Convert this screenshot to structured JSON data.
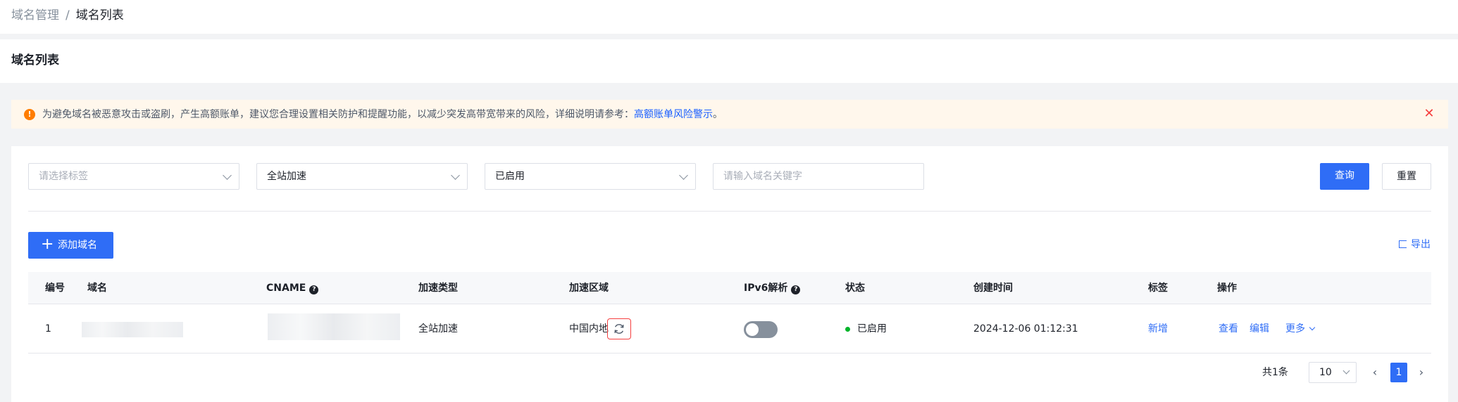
{
  "breadcrumb": {
    "parent": "域名管理",
    "separator": "/",
    "current": "域名列表"
  },
  "page_title": "域名列表",
  "alert": {
    "text": "为避免域名被恶意攻击或盗刷，产生高额账单，建议您合理设置相关防护和提醒功能，以减少突发高带宽带来的风险，详细说明请参考：",
    "link": "高额账单风险警示",
    "tail": "。",
    "icon": "warning-icon",
    "close_icon": "close-icon",
    "colors": {
      "background": "#fff7ec",
      "icon": "#ff7d00",
      "close": "#f53f3f",
      "link": "#165dff"
    }
  },
  "filters": {
    "tag_placeholder": "请选择标签",
    "accel_type": "全站加速",
    "status": "已启用",
    "keyword_placeholder": "请输入域名关键字",
    "query_label": "查询",
    "reset_label": "重置"
  },
  "toolbar": {
    "add_label": "添加域名",
    "export_label": "导出"
  },
  "table": {
    "headers": {
      "no": "编号",
      "domain": "域名",
      "cname": "CNAME",
      "accel_type": "加速类型",
      "region": "加速区域",
      "ipv6": "IPv6解析",
      "status": "状态",
      "created": "创建时间",
      "tag": "标签",
      "ops": "操作"
    },
    "rows": [
      {
        "no": "1",
        "accel_type": "全站加速",
        "region": "中国内地",
        "ipv6_enabled": false,
        "status": "已启用",
        "created": "2024-12-06 01:12:31",
        "tag_action": "新增",
        "view": "查看",
        "edit": "编辑",
        "more": "更多"
      }
    ]
  },
  "pagination": {
    "total": "共1条",
    "page_size": "10",
    "current": "1"
  },
  "colors": {
    "primary": "#2f6df6",
    "status_enabled": "#00b42a",
    "highlight": "#f53f3f"
  }
}
